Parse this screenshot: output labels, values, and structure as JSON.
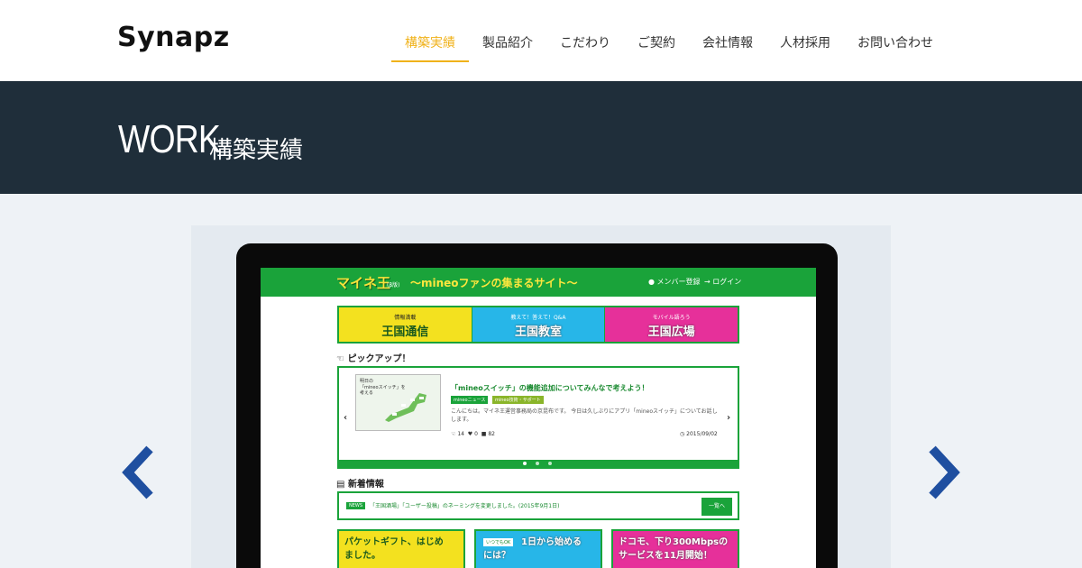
{
  "header": {
    "logo": "Synapz",
    "nav": [
      {
        "label": "構築実績",
        "active": true
      },
      {
        "label": "製品紹介",
        "active": false
      },
      {
        "label": "こだわり",
        "active": false
      },
      {
        "label": "ご契約",
        "active": false
      },
      {
        "label": "会社情報",
        "active": false
      },
      {
        "label": "人材採用",
        "active": false
      },
      {
        "label": "お問い合わせ",
        "active": false
      }
    ],
    "accent_color": "#f0b21a"
  },
  "title_band": {
    "main": "WORK",
    "sub": "構築実績",
    "bg_color": "#1f2e3a"
  },
  "carousel": {
    "prev_icon": "chevron-left-icon",
    "next_icon": "chevron-right-icon",
    "arrow_color": "#1f4fa0"
  },
  "mockup": {
    "logo": "マイネ王",
    "logo_sub": "(β版)",
    "tagline": "〜mineoファンの集まるサイト〜",
    "member_register": "メンバー登録",
    "login": "ログイン",
    "banners": [
      {
        "small": "情報満載",
        "big": "王国通信"
      },
      {
        "small": "教えて！答えて！Q&A",
        "big": "王国教室"
      },
      {
        "small": "モバイル語ろう",
        "big": "王国広場"
      }
    ],
    "pickup_title": "ピックアップ！",
    "pickup": {
      "map_label_line1": "明日の",
      "map_label_line2": "「mineoスイッチ」を",
      "map_label_line3": "考える",
      "title": "「mineoスイッチ」の機能追加についてみんなで考えよう！",
      "tag1": "mineoニュース",
      "tag2": "mineo技術・サポート",
      "excerpt": "こんにちは。マイネ王運営事務局の京昆布です。 今日は久しぶりにアプリ「mineoスイッチ」についてお話しします。",
      "likes": "14",
      "hearts": "0",
      "comments": "82",
      "date": "2015/09/02"
    },
    "news_title": "新着情報",
    "news": {
      "badge": "NEWS",
      "text": "「王国酒場」「ユーザー投稿」のネーミングを変更しました。(2015年9月1日)",
      "button": "一覧へ"
    },
    "tiles": [
      {
        "badge": "",
        "text1": "パケットギフト、はじめ",
        "text2": "ました。"
      },
      {
        "badge": "いつでもOK",
        "text1": "1日から始める",
        "text2": "には？"
      },
      {
        "badge": "",
        "text1": "ドコモ、下り300Mbpsの",
        "text2": "サービスを11月開始！"
      }
    ]
  }
}
